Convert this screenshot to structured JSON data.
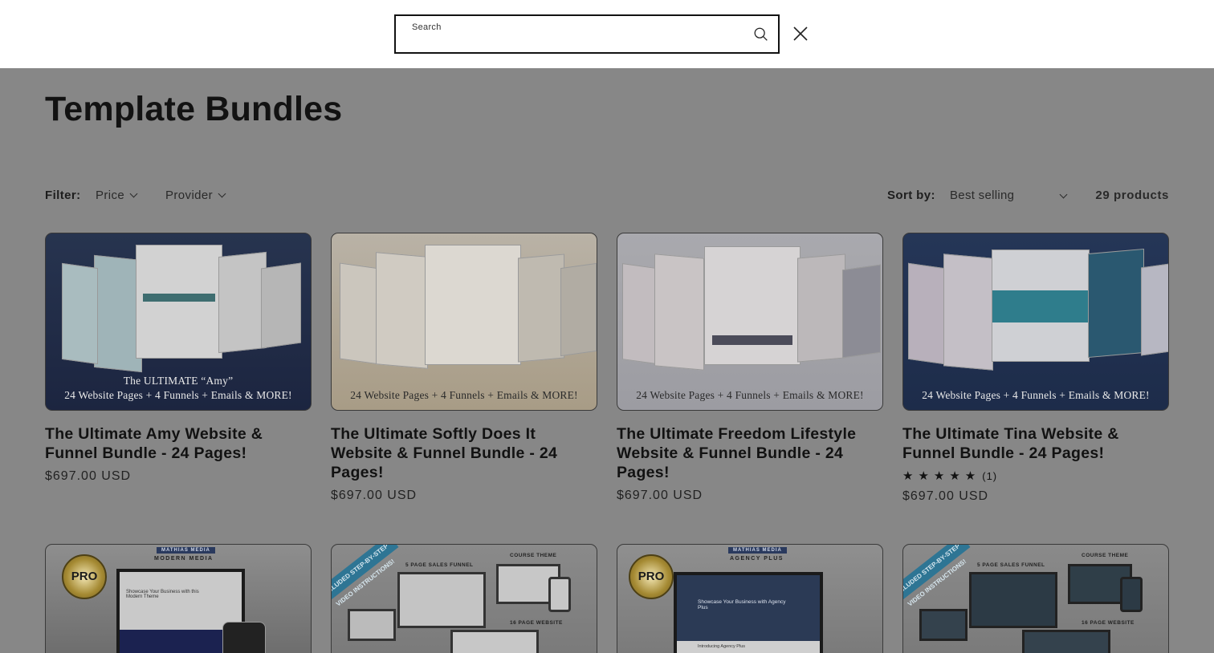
{
  "search": {
    "label": "Search",
    "value": ""
  },
  "page": {
    "title": "Template Bundles"
  },
  "filters": {
    "label": "Filter:",
    "price": "Price",
    "provider": "Provider",
    "sort_label": "Sort by:",
    "sort_value": "Best selling",
    "count": "29 products"
  },
  "products": [
    {
      "thumb_line1": "The ULTIMATE “Amy”",
      "thumb_line2": "24 Website Pages + 4 Funnels + Emails & MORE!",
      "title": "The Ultimate Amy Website & Funnel Bundle - 24 Pages!",
      "price": "$697.00 USD"
    },
    {
      "thumb_line2": "24 Website Pages + 4 Funnels + Emails & MORE!",
      "title": "The Ultimate Softly Does It Website & Funnel Bundle - 24 Pages!",
      "price": "$697.00 USD"
    },
    {
      "thumb_line2": "24 Website Pages + 4 Funnels + Emails & MORE!",
      "title": "The Ultimate Freedom Lifestyle Website & Funnel Bundle - 24 Pages!",
      "price": "$697.00 USD"
    },
    {
      "thumb_line2": "24 Website Pages + 4 Funnels + Emails & MORE!",
      "title": "The Ultimate Tina Website & Funnel Bundle - 24 Pages!",
      "rating": 5,
      "rating_count": "(1)",
      "price": "$697.00 USD"
    }
  ],
  "row2": [
    {
      "brand": "MATHIAS MEDIA",
      "subtitle": "MODERN MEDIA",
      "badge": "PRO",
      "headline": "Showcase Your Business with this Modern Theme"
    },
    {
      "ribbon": "INCLUDED STEP-BY-STEP VIDEO INSTRUCTIONS!",
      "label_a": "5 PAGE SALES FUNNEL",
      "label_b": "COURSE THEME",
      "label_c": "16 PAGE WEBSITE"
    },
    {
      "brand": "MATHIAS MEDIA",
      "subtitle": "AGENCY PLUS",
      "badge": "PRO",
      "headline": "Showcase Your Business with Agency Plus",
      "sub_headline": "Introducing Agency Plus"
    },
    {
      "ribbon": "INCLUDED STEP-BY-STEP VIDEO INSTRUCTIONS!",
      "label_a": "5 PAGE SALES FUNNEL",
      "label_b": "COURSE THEME",
      "label_c": "16 PAGE WEBSITE"
    }
  ],
  "colors": {
    "overlay": "#878787",
    "header_bg": "#ffffff",
    "text": "#121212",
    "card1_bg": "#1f2a44",
    "card2_bg": "#b5ab9a",
    "card3_bg": "#a7a7ad",
    "card4_bg": "#1f2f52"
  },
  "icons": {
    "search": "search-icon",
    "close": "close-icon",
    "chevron": "chevron-down-icon",
    "star": "star-icon"
  }
}
